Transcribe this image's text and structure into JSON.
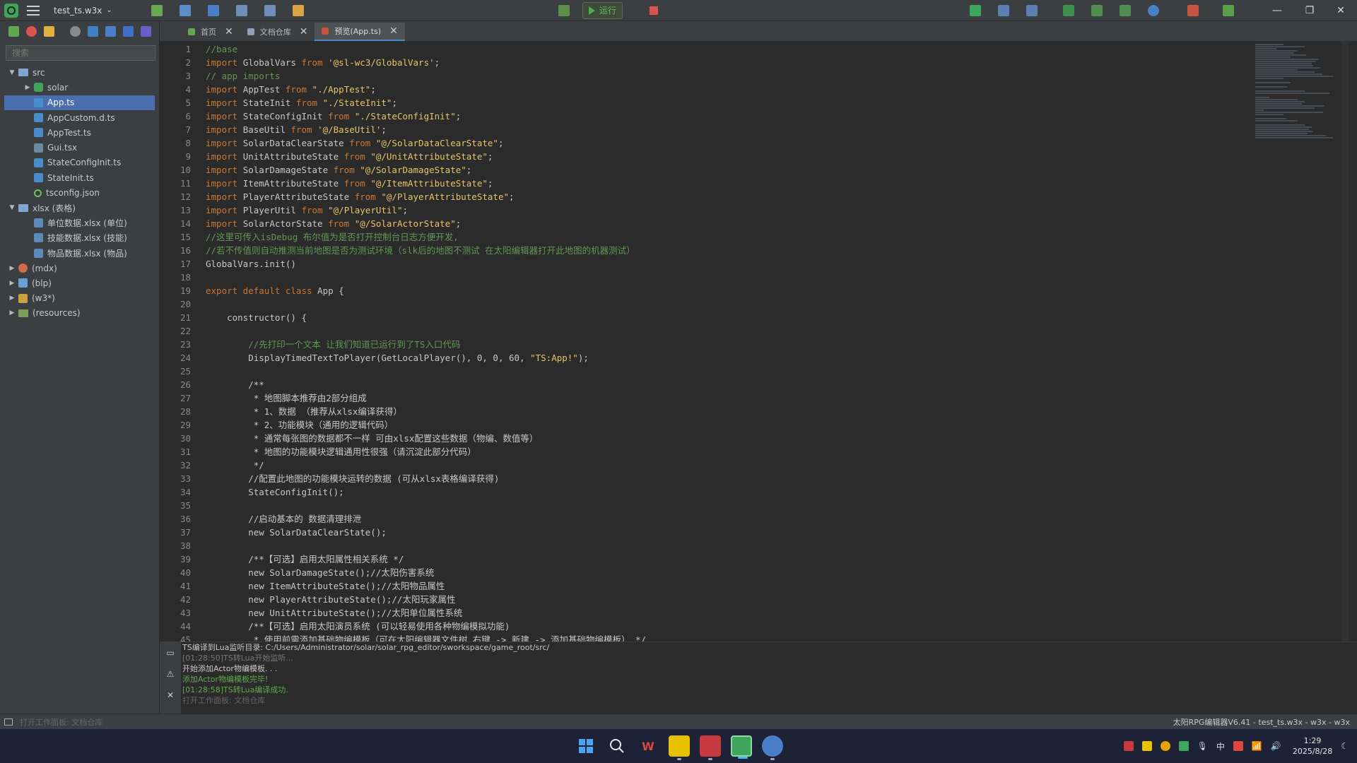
{
  "toolbar": {
    "project_name": "test_ts.w3x",
    "run_label": "运行"
  },
  "sidebar": {
    "search_placeholder": "搜索",
    "tree": [
      {
        "label": "src",
        "depth": 0,
        "kind": "folder",
        "expanded": true
      },
      {
        "label": "solar",
        "depth": 1,
        "kind": "solar",
        "collapsed": true
      },
      {
        "label": "App.ts",
        "depth": 1,
        "kind": "ts",
        "selected": true
      },
      {
        "label": "AppCustom.d.ts",
        "depth": 1,
        "kind": "ts"
      },
      {
        "label": "AppTest.ts",
        "depth": 1,
        "kind": "ts"
      },
      {
        "label": "Gui.tsx",
        "depth": 1,
        "kind": "tsx"
      },
      {
        "label": "StateConfigInit.ts",
        "depth": 1,
        "kind": "ts"
      },
      {
        "label": "StateInit.ts",
        "depth": 1,
        "kind": "ts"
      },
      {
        "label": "tsconfig.json",
        "depth": 1,
        "kind": "json"
      },
      {
        "label": "xlsx (表格)",
        "depth": 0,
        "kind": "folder",
        "expanded": true
      },
      {
        "label": "单位数据.xlsx (单位)",
        "depth": 1,
        "kind": "xlsx"
      },
      {
        "label": "技能数据.xlsx (技能)",
        "depth": 1,
        "kind": "xlsx"
      },
      {
        "label": "物品数据.xlsx (物品)",
        "depth": 1,
        "kind": "xlsx"
      },
      {
        "label": "(mdx)",
        "depth": 0,
        "kind": "mdx",
        "collapsed": true
      },
      {
        "label": "(blp)",
        "depth": 0,
        "kind": "blp",
        "collapsed": true
      },
      {
        "label": "(w3*)",
        "depth": 0,
        "kind": "w3",
        "collapsed": true
      },
      {
        "label": "(resources)",
        "depth": 0,
        "kind": "folder-green",
        "collapsed": true
      }
    ]
  },
  "tabs": [
    {
      "label": "首页",
      "active": false
    },
    {
      "label": "文档仓库",
      "active": false
    },
    {
      "label": "预览(App.ts)",
      "active": true
    }
  ],
  "editor": {
    "lines": [
      [
        [
          "c",
          "//base"
        ]
      ],
      [
        [
          "k",
          "import "
        ],
        [
          "t",
          "GlobalVars "
        ],
        [
          "k",
          "from "
        ],
        [
          "s",
          "'@sl-wc3/GlobalVars'"
        ],
        [
          "t",
          ";"
        ]
      ],
      [
        [
          "c",
          "// app imports"
        ]
      ],
      [
        [
          "k",
          "import "
        ],
        [
          "t",
          "AppTest "
        ],
        [
          "k",
          "from "
        ],
        [
          "s",
          "\"./AppTest\""
        ],
        [
          "t",
          ";"
        ]
      ],
      [
        [
          "k",
          "import "
        ],
        [
          "t",
          "StateInit "
        ],
        [
          "k",
          "from "
        ],
        [
          "s",
          "\"./StateInit\""
        ],
        [
          "t",
          ";"
        ]
      ],
      [
        [
          "k",
          "import "
        ],
        [
          "t",
          "StateConfigInit "
        ],
        [
          "k",
          "from "
        ],
        [
          "s",
          "\"./StateConfigInit\""
        ],
        [
          "t",
          ";"
        ]
      ],
      [
        [
          "k",
          "import "
        ],
        [
          "t",
          "BaseUtil "
        ],
        [
          "k",
          "from "
        ],
        [
          "s",
          "'@/BaseUtil'"
        ],
        [
          "t",
          ";"
        ]
      ],
      [
        [
          "k",
          "import "
        ],
        [
          "t",
          "SolarDataClearState "
        ],
        [
          "k",
          "from "
        ],
        [
          "s",
          "\"@/SolarDataClearState\""
        ],
        [
          "t",
          ";"
        ]
      ],
      [
        [
          "k",
          "import "
        ],
        [
          "t",
          "UnitAttributeState "
        ],
        [
          "k",
          "from "
        ],
        [
          "s",
          "\"@/UnitAttributeState\""
        ],
        [
          "t",
          ";"
        ]
      ],
      [
        [
          "k",
          "import "
        ],
        [
          "t",
          "SolarDamageState "
        ],
        [
          "k",
          "from "
        ],
        [
          "s",
          "\"@/SolarDamageState\""
        ],
        [
          "t",
          ";"
        ]
      ],
      [
        [
          "k",
          "import "
        ],
        [
          "t",
          "ItemAttributeState "
        ],
        [
          "k",
          "from "
        ],
        [
          "s",
          "\"@/ItemAttributeState\""
        ],
        [
          "t",
          ";"
        ]
      ],
      [
        [
          "k",
          "import "
        ],
        [
          "t",
          "PlayerAttributeState "
        ],
        [
          "k",
          "from "
        ],
        [
          "s",
          "\"@/PlayerAttributeState\""
        ],
        [
          "t",
          ";"
        ]
      ],
      [
        [
          "k",
          "import "
        ],
        [
          "t",
          "PlayerUtil "
        ],
        [
          "k",
          "from "
        ],
        [
          "s",
          "\"@/PlayerUtil\""
        ],
        [
          "t",
          ";"
        ]
      ],
      [
        [
          "k",
          "import "
        ],
        [
          "t",
          "SolarActorState "
        ],
        [
          "k",
          "from "
        ],
        [
          "s",
          "\"@/SolarActorState\""
        ],
        [
          "t",
          ";"
        ]
      ],
      [
        [
          "c",
          "//这里可传入isDebug 布尔值为是否打开控制台日志方便开发,"
        ]
      ],
      [
        [
          "c",
          "//若不传值则自动推测当前地图是否为测试环境（slk后的地图不测试 在太阳编辑器打开此地图的机器测试）"
        ]
      ],
      [
        [
          "g",
          "GlobalVars"
        ],
        [
          "t",
          ".init()"
        ]
      ],
      [],
      [
        [
          "k",
          "export default class "
        ],
        [
          "g",
          "App "
        ],
        [
          "t",
          "{"
        ]
      ],
      [],
      [
        [
          "t",
          "    "
        ],
        [
          "g",
          "constructor"
        ],
        [
          "t",
          "() {"
        ]
      ],
      [],
      [
        [
          "t",
          "        "
        ],
        [
          "c",
          "//先打印一个文本 让我们知道已运行到了TS入口代码"
        ]
      ],
      [
        [
          "t",
          "        "
        ],
        [
          "g",
          "DisplayTimedTextToPlayer"
        ],
        [
          "t",
          "("
        ],
        [
          "g",
          "GetLocalPlayer"
        ],
        [
          "t",
          "(), 0, 0, 60, "
        ],
        [
          "s",
          "\"TS:App!\""
        ],
        [
          "t",
          ");"
        ]
      ],
      [],
      [
        [
          "t",
          "        /**"
        ]
      ],
      [
        [
          "t",
          "         * 地图脚本推荐由2部分组成"
        ]
      ],
      [
        [
          "t",
          "         * 1、数据 （推荐从xlsx编译获得）"
        ]
      ],
      [
        [
          "t",
          "         * 2、功能模块（通用的逻辑代码）"
        ]
      ],
      [
        [
          "t",
          "         * 通常每张图的数据都不一样 可由xlsx配置这些数据（物编、数值等）"
        ]
      ],
      [
        [
          "t",
          "         * 地图的功能模块逻辑通用性很强（请沉淀此部分代码）"
        ]
      ],
      [
        [
          "t",
          "         */"
        ]
      ],
      [
        [
          "t",
          "        //配置此地图的功能模块运转的数据 (可从xlsx表格编译获得)"
        ]
      ],
      [
        [
          "t",
          "        StateConfigInit();"
        ]
      ],
      [],
      [
        [
          "t",
          "        //启动基本的 数据清理排泄"
        ]
      ],
      [
        [
          "t",
          "        new SolarDataClearState();"
        ]
      ],
      [],
      [
        [
          "t",
          "        /**【可选】启用太阳属性相关系统 */"
        ]
      ],
      [
        [
          "t",
          "        new SolarDamageState();//太阳伤害系统"
        ]
      ],
      [
        [
          "t",
          "        new ItemAttributeState();//太阳物品属性"
        ]
      ],
      [
        [
          "t",
          "        new PlayerAttributeState();//太阳玩家属性"
        ]
      ],
      [
        [
          "t",
          "        new UnitAttributeState();//太阳单位属性系统"
        ]
      ],
      [
        [
          "t",
          "        /**【可选】启用太阳演员系统 (可以轻易使用各种物编模拟功能)"
        ]
      ],
      [
        [
          "t",
          "         * 使用前需添加基础物编模板（可在太阳编辑器文件树 右键 -> 新建 -> 添加基础物编模板） */"
        ]
      ]
    ]
  },
  "output": {
    "lines": [
      {
        "text": "TS编译到Lua监听目录: C:/Users/Administrator/solar/solar_rpg_editor/sworkspace/game_root/src/",
        "color": "#c8c8c8"
      },
      {
        "text": "[01:28:50]TS转Lua开始监听...",
        "color": "#777777"
      },
      {
        "text": "开始添加Actor物编模板. . .",
        "color": "#c8c8c8"
      },
      {
        "text": "添加Actor物编模板完毕!",
        "color": "#5fa84f"
      },
      {
        "text": "[01:28:58]TS转Lua编译成功.",
        "color": "#5fa84f"
      },
      {
        "text": "打开工作面板: 文档仓库",
        "color": "#666666"
      }
    ]
  },
  "status": {
    "left": "打开工作面板: 文档仓库",
    "right": "太阳RPG编辑器V6.41 - test_ts.w3x - w3x - w3x"
  },
  "taskbar": {
    "time": "1:29",
    "date": "2025/8/28",
    "ime": "中"
  }
}
